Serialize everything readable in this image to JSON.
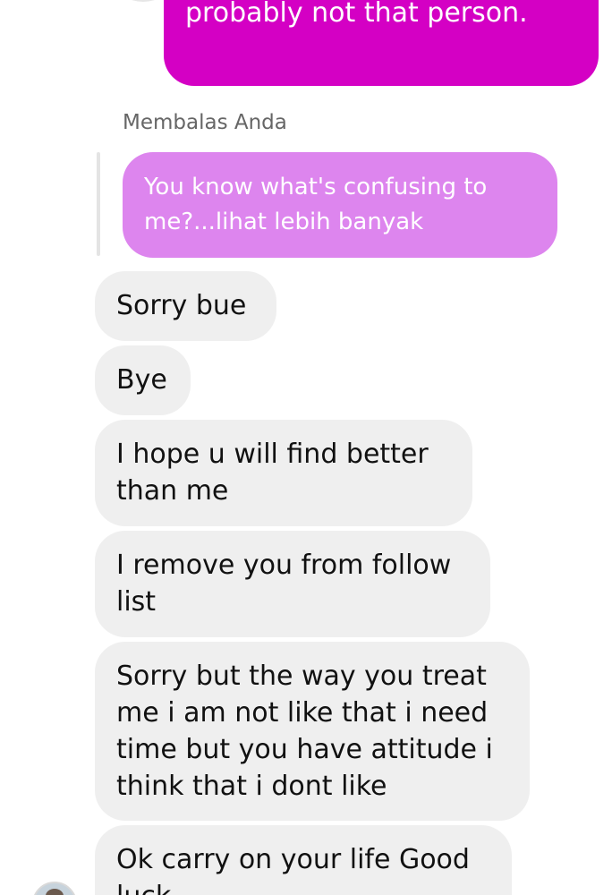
{
  "chat": {
    "outgoing_partial": "probably not that person.",
    "reply_context": {
      "label": "Membalas Anda",
      "quoted_text": "You know what's confusing to me?...lihat lebih banyak"
    },
    "incoming": [
      "Sorry bue",
      "Bye",
      "I hope u will find better than me",
      "I remove you from follow list",
      "Sorry but the way you treat me i am not like that i need time but you have attitude i think that i dont like",
      "Ok carry on your life Good luck"
    ]
  },
  "colors": {
    "outgoing_bubble": "#d400c4",
    "quoted_bubble": "#dd85ee",
    "incoming_bubble": "#efefef"
  }
}
